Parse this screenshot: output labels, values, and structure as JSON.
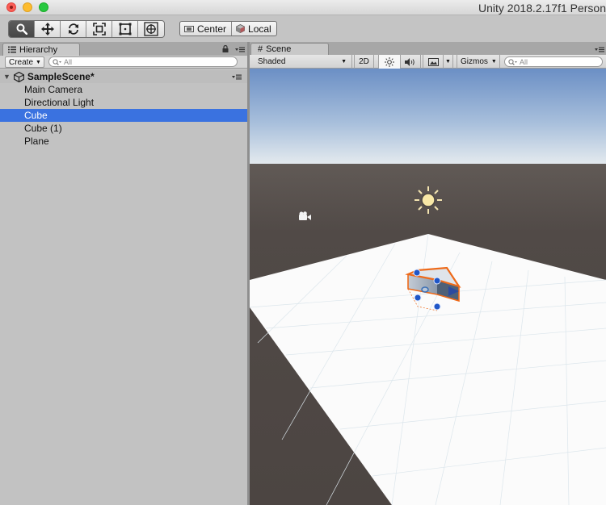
{
  "window": {
    "title": "Unity 2018.2.17f1 Person"
  },
  "toolbar": {
    "tools": [
      {
        "name": "hand-tool",
        "active": true
      },
      {
        "name": "move-tool",
        "active": false
      },
      {
        "name": "rotate-tool",
        "active": false
      },
      {
        "name": "scale-tool",
        "active": false
      },
      {
        "name": "rect-tool",
        "active": false
      },
      {
        "name": "transform-tool",
        "active": false
      }
    ],
    "pivot_label": "Center",
    "space_label": "Local"
  },
  "hierarchy": {
    "tab_label": "Hierarchy",
    "create_label": "Create",
    "search_placeholder": "All",
    "scene_name": "SampleScene*",
    "items": [
      {
        "label": "Main Camera",
        "selected": false
      },
      {
        "label": "Directional Light",
        "selected": false
      },
      {
        "label": "Cube",
        "selected": true
      },
      {
        "label": "Cube (1)",
        "selected": false
      },
      {
        "label": "Plane",
        "selected": false
      }
    ]
  },
  "scene": {
    "tab_label": "Scene",
    "shading_mode": "Shaded",
    "mode_2d": "2D",
    "gizmos_label": "Gizmos",
    "search_placeholder": "All"
  },
  "colors": {
    "selection": "#3a72e0",
    "sky_top": "#6b8fc5",
    "horizon": "#e8ecef",
    "ground": "#4f4845",
    "gizmo_handle": "#1f56c7",
    "selection_outline": "#ee6a1a"
  }
}
